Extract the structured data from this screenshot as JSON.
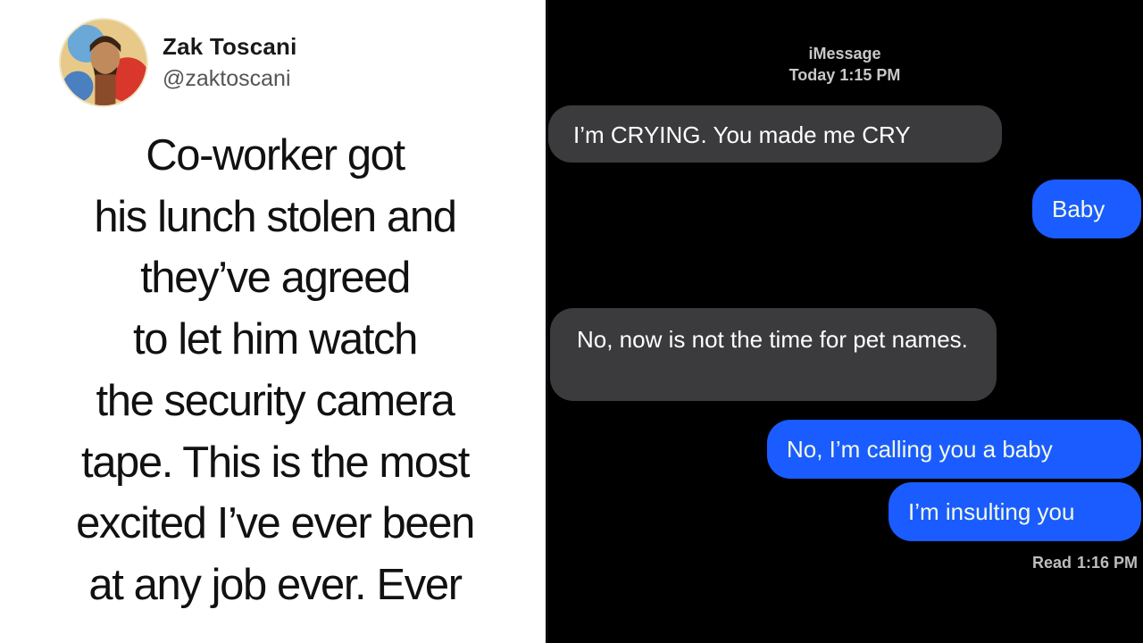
{
  "tweet": {
    "author_name": "Zak Toscani",
    "author_handle": "@zaktoscani",
    "lines": [
      "Co-worker got",
      "his lunch stolen and",
      "they’ve agreed",
      "to let him watch",
      "the security camera",
      "tape. This is the most",
      "excited I’ve ever been",
      "at any job ever. Ever"
    ]
  },
  "imessage": {
    "service_label": "iMessage",
    "timestamp": "Today 1:15 PM",
    "messages": [
      {
        "direction": "incoming",
        "text": "I’m CRYING. You made me CRY"
      },
      {
        "direction": "outgoing",
        "text": "Baby"
      },
      {
        "direction": "incoming",
        "text": "No, now is not the time for pet names."
      },
      {
        "direction": "outgoing",
        "text": "No, I’m calling you a baby"
      },
      {
        "direction": "outgoing",
        "text": "I’m insulting you"
      }
    ],
    "read_label": "Read",
    "read_time": "1:16 PM"
  },
  "colors": {
    "tweet_background": "#ffffff",
    "messages_background": "#000000",
    "incoming_bubble": "#3b3b3d",
    "outgoing_bubble": "#1a5cff"
  }
}
